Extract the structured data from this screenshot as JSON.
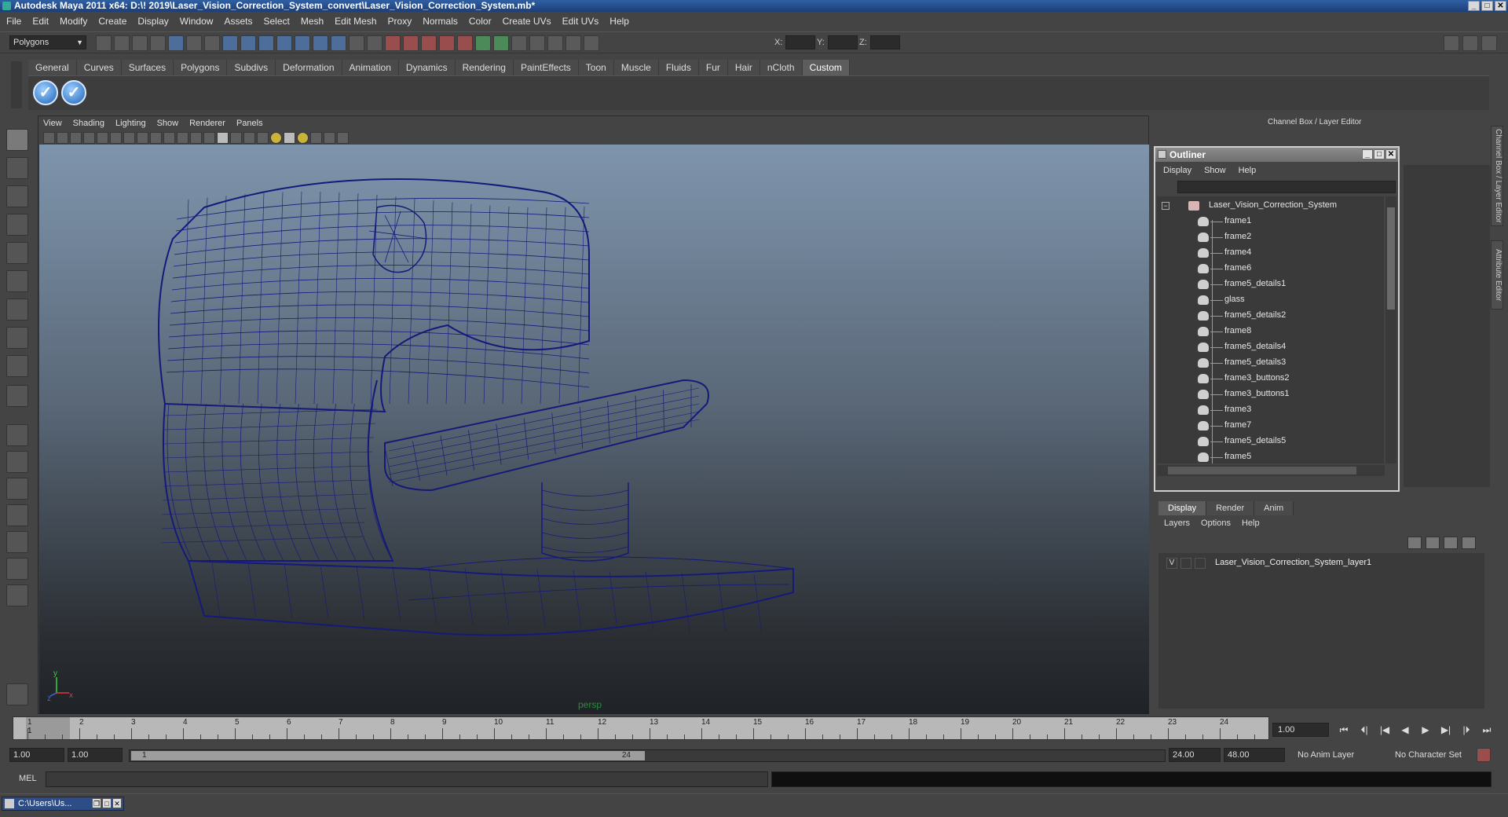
{
  "window": {
    "title": "Autodesk Maya 2011 x64: D:\\! 2019\\Laser_Vision_Correction_System_convert\\Laser_Vision_Correction_System.mb*",
    "minimize": "_",
    "maximize": "□",
    "close": "✕"
  },
  "menubar": [
    "File",
    "Edit",
    "Modify",
    "Create",
    "Display",
    "Window",
    "Assets",
    "Select",
    "Mesh",
    "Edit Mesh",
    "Proxy",
    "Normals",
    "Color",
    "Create UVs",
    "Edit UVs",
    "Help"
  ],
  "statusline": {
    "mode": "Polygons",
    "x_label": "X:",
    "y_label": "Y:",
    "z_label": "Z:"
  },
  "shelf": {
    "tabs": [
      "General",
      "Curves",
      "Surfaces",
      "Polygons",
      "Subdivs",
      "Deformation",
      "Animation",
      "Dynamics",
      "Rendering",
      "PaintEffects",
      "Toon",
      "Muscle",
      "Fluids",
      "Fur",
      "Hair",
      "nCloth",
      "Custom"
    ],
    "active_tab": "Custom",
    "buttons": [
      "✓",
      "✓"
    ]
  },
  "viewport": {
    "menu": [
      "View",
      "Shading",
      "Lighting",
      "Show",
      "Renderer",
      "Panels"
    ],
    "camera": "persp",
    "axis_x": "x",
    "axis_y": "y",
    "axis_z": "z",
    "wire_color": "#151a7a"
  },
  "channel_box": {
    "title": "Channel Box / Layer Editor",
    "side_tabs": [
      "Channel Box / Layer Editor",
      "Attribute Editor"
    ]
  },
  "outliner": {
    "title": "Outliner",
    "menu": [
      "Display",
      "Show",
      "Help"
    ],
    "collapse": "−",
    "root": "Laser_Vision_Correction_System",
    "items": [
      "frame1",
      "frame2",
      "frame4",
      "frame6",
      "frame5_details1",
      "glass",
      "frame5_details2",
      "frame8",
      "frame5_details4",
      "frame5_details3",
      "frame3_buttons2",
      "frame3_buttons1",
      "frame3",
      "frame7",
      "frame5_details5",
      "frame5"
    ]
  },
  "layer_editor": {
    "tabs": [
      "Display",
      "Render",
      "Anim"
    ],
    "active_tab": "Display",
    "menu": [
      "Layers",
      "Options",
      "Help"
    ],
    "layer": {
      "visible": "V",
      "name": "Laser_Vision_Correction_System_layer1"
    }
  },
  "timeline": {
    "frames": [
      "1",
      "2",
      "3",
      "4",
      "5",
      "6",
      "7",
      "8",
      "9",
      "10",
      "11",
      "12",
      "13",
      "14",
      "15",
      "16",
      "17",
      "18",
      "19",
      "20",
      "21",
      "22",
      "23",
      "24"
    ],
    "current_label": "1",
    "current_frame": "1.00",
    "playback": [
      "⏮",
      "⏴|",
      "|◀",
      "◀",
      "▶",
      "▶|",
      "|⏵",
      "⏭"
    ]
  },
  "range": {
    "start_time": "1.00",
    "playback_start": "1.00",
    "range_start": "1",
    "range_end": "24",
    "playback_end": "24.00",
    "end_time": "48.00",
    "anim_layer": "No Anim Layer",
    "character_set": "No Character Set"
  },
  "command_line": {
    "label": "MEL"
  },
  "taskbar": {
    "item": "C:\\Users\\Us...",
    "restore": "❐",
    "max": "□",
    "close": "✕"
  }
}
